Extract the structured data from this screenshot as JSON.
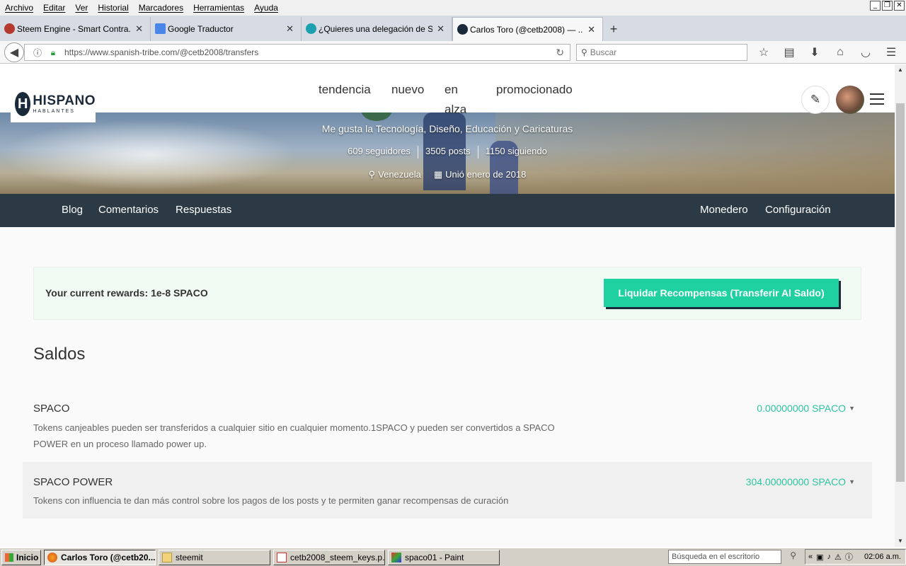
{
  "browser": {
    "menu": [
      "Archivo",
      "Editar",
      "Ver",
      "Historial",
      "Marcadores",
      "Herramientas",
      "Ayuda"
    ],
    "window_controls": [
      "_",
      "❐",
      "✕"
    ],
    "tabs": [
      {
        "label": "Steem Engine - Smart Contra...",
        "icon": "steem-engine-icon",
        "color": "#b5392f"
      },
      {
        "label": "Google Traductor",
        "icon": "google-translate-icon",
        "color": "#4a86e8"
      },
      {
        "label": "¿Quieres una delegación de S...",
        "icon": "spiral-icon",
        "color": "#1aa0b0"
      },
      {
        "label": "Carlos Toro (@cetb2008) — ...",
        "icon": "hispano-icon",
        "color": "#1b2a3a"
      }
    ],
    "new_tab": "+",
    "url": "https://www.spanish-tribe.com/@cetb2008/transfers",
    "search_placeholder": "Buscar"
  },
  "site": {
    "logo_mark": "H",
    "logo_name": "HISPANO",
    "logo_sub": "HABLANTES",
    "nav": [
      "tendencia",
      "nuevo",
      "en alza",
      "promocionado"
    ],
    "profile": {
      "about": "Me gusta la Tecnología, Diseño, Educación y Caricaturas",
      "followers": "609 seguidores",
      "posts": "3505 posts",
      "following": "1150 siguiendo",
      "location": "Venezuela",
      "joined": "Unió enero de 2018"
    },
    "user_menu_left": [
      "Blog",
      "Comentarios",
      "Respuestas"
    ],
    "user_menu_right": [
      "Monedero",
      "Configuración"
    ]
  },
  "wallet": {
    "rewards_text": "Your current rewards: 1e-8 SPACO",
    "claim_button": "Liquidar Recompensas (Transferir Al Saldo)",
    "balances_title": "Saldos",
    "balances": [
      {
        "name": "SPACO",
        "description": "Tokens canjeables pueden ser transferidos a cualquier sitio en cualquier momento.1SPACO y pueden ser convertidos a SPACO POWER en un proceso llamado power up.",
        "value": "0.00000000 SPACO"
      },
      {
        "name": "SPACO POWER",
        "description": "Tokens con influencia te dan más control sobre los pagos de los posts y te permiten ganar recompensas de curación",
        "value": "304.00000000 SPACO"
      }
    ]
  },
  "taskbar": {
    "start": "Inicio",
    "items": [
      {
        "label": "Carlos Toro (@cetb20...",
        "active": true
      },
      {
        "label": "steemit",
        "active": false
      },
      {
        "label": "cetb2008_steem_keys.p...",
        "active": false
      },
      {
        "label": "spaco01 - Paint",
        "active": false
      }
    ],
    "search_placeholder": "Búsqueda en el escritorio",
    "clock": "02:06 a.m."
  },
  "colors": {
    "accent": "#1fd1a0",
    "value_text": "#2cc6a0",
    "user_menu_bg": "#2c3a45"
  }
}
